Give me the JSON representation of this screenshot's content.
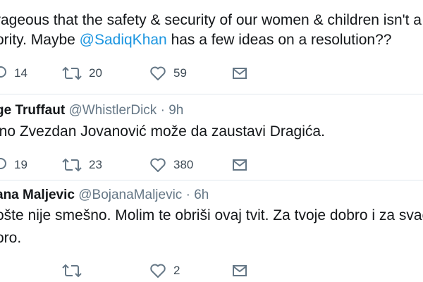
{
  "tweets": [
    {
      "text_lines": [
        [
          "rageous that the safety & security of our women & children isn't a",
          ""
        ],
        [
          "ority. Maybe ",
          "@SadiqKhan",
          " has a few ideas on a resolution??"
        ]
      ],
      "actions": {
        "replies": "14",
        "retweets": "20",
        "likes": "59"
      }
    },
    {
      "author_name": "ge Truffaut",
      "handle": "@WhistlerDick",
      "separator": "·",
      "time": "9h",
      "text": "ino Zvezdan Jovanović može da zaustavi Dragića.",
      "actions": {
        "replies": "19",
        "retweets": "23",
        "likes": "380"
      }
    },
    {
      "author_name": "ana Maljevic",
      "handle": "@BojanaMaljevic",
      "separator": "·",
      "time": "6h",
      "text_line1": "ošte nije smešno. Molim te obriši ovaj tvit. Za tvoje dobro i za svač",
      "text_line2": "oro.",
      "actions": {
        "replies": "",
        "retweets": "",
        "likes": "2"
      }
    }
  ],
  "icons": {
    "reply": "reply-icon",
    "retweet": "retweet-icon",
    "like": "heart-icon",
    "message": "envelope-icon"
  },
  "colors": {
    "text": "#14171a",
    "secondary": "#657786",
    "mention": "#1b95e0",
    "divider": "#e1e8ed"
  }
}
